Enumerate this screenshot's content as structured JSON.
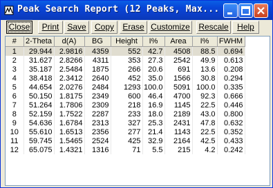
{
  "window": {
    "title": "Peak Search Report (12 Peaks, Max..."
  },
  "toolbar": {
    "close": "Close",
    "print": "Print",
    "save": "Save",
    "copy": "Copy",
    "erase": "Erase",
    "customize": "Customize",
    "rescale": "Rescale",
    "help": "Help"
  },
  "table": {
    "headers": [
      "#",
      "2-Theta",
      "d(A)",
      "BG",
      "Height",
      "I%",
      "Area",
      "I%",
      "FWHM"
    ],
    "rows": [
      [
        "1",
        "29.944",
        "2.9816",
        "4359",
        "552",
        "42.7",
        "4508",
        "88.5",
        "0.694"
      ],
      [
        "2",
        "31.627",
        "2.8266",
        "4311",
        "353",
        "27.3",
        "2542",
        "49.9",
        "0.613"
      ],
      [
        "3",
        "35.187",
        "2.5484",
        "1875",
        "266",
        "20.6",
        "691",
        "13.6",
        "0.208"
      ],
      [
        "4",
        "38.418",
        "2.3412",
        "2640",
        "452",
        "35.0",
        "1566",
        "30.8",
        "0.294"
      ],
      [
        "5",
        "44.654",
        "2.0276",
        "2484",
        "1293",
        "100.0",
        "5091",
        "100.0",
        "0.335"
      ],
      [
        "6",
        "50.150",
        "1.8175",
        "2349",
        "600",
        "46.4",
        "4700",
        "92.3",
        "0.666"
      ],
      [
        "7",
        "51.264",
        "1.7806",
        "2309",
        "218",
        "16.9",
        "1145",
        "22.5",
        "0.446"
      ],
      [
        "8",
        "52.159",
        "1.7522",
        "2287",
        "233",
        "18.0",
        "2189",
        "43.0",
        "0.800"
      ],
      [
        "9",
        "54.636",
        "1.6784",
        "2313",
        "327",
        "25.3",
        "2431",
        "47.8",
        "0.632"
      ],
      [
        "10",
        "55.610",
        "1.6513",
        "2356",
        "277",
        "21.4",
        "1143",
        "22.5",
        "0.352"
      ],
      [
        "11",
        "59.745",
        "1.5465",
        "2524",
        "425",
        "32.9",
        "2164",
        "42.5",
        "0.433"
      ],
      [
        "12",
        "65.075",
        "1.4321",
        "1316",
        "71",
        "5.5",
        "215",
        "4.2",
        "0.242"
      ]
    ]
  }
}
